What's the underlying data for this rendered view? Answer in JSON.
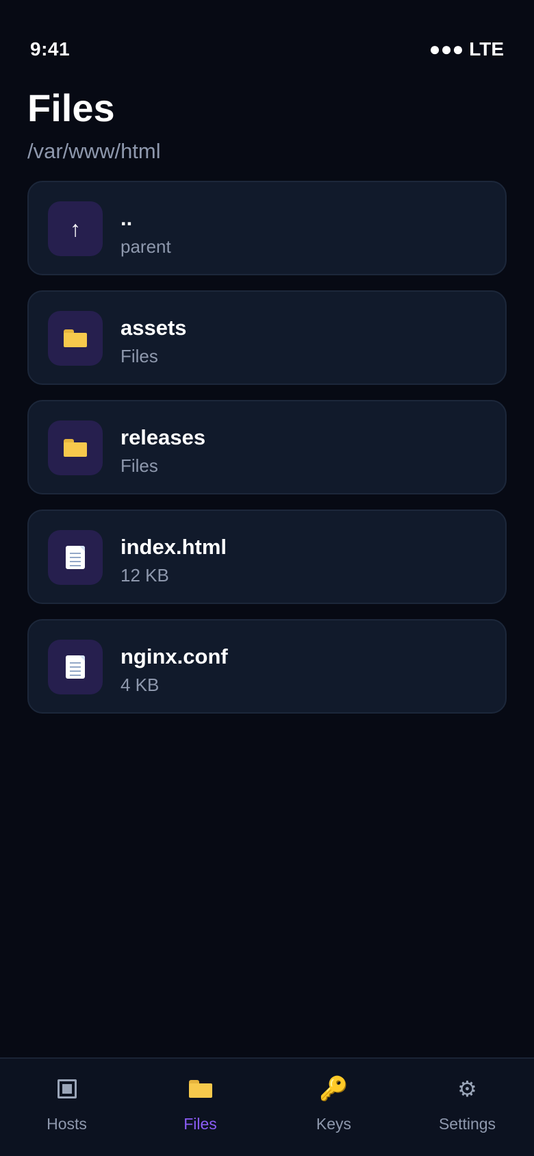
{
  "status_bar": {
    "time": "9:41",
    "signal": "●●● LTE"
  },
  "header": {
    "title": "Files",
    "path": "/var/www/html"
  },
  "files": [
    {
      "name": "..",
      "meta": "parent",
      "icon": "arrow-up-icon",
      "glyph": "↑"
    },
    {
      "name": "assets",
      "meta": "Files",
      "icon": "folder-icon"
    },
    {
      "name": "releases",
      "meta": "Files",
      "icon": "folder-icon"
    },
    {
      "name": "index.html",
      "meta": "12 KB",
      "icon": "document-icon"
    },
    {
      "name": "nginx.conf",
      "meta": "4 KB",
      "icon": "document-icon"
    }
  ],
  "tab_bar": {
    "tabs": [
      {
        "label": "Hosts",
        "icon": "hosts-icon"
      },
      {
        "label": "Files",
        "icon": "folder-icon",
        "active": true
      },
      {
        "label": "Keys",
        "icon": "key-icon",
        "glyph": "🔑"
      },
      {
        "label": "Settings",
        "icon": "gear-icon",
        "glyph": "⚙"
      }
    ]
  },
  "colors": {
    "background": "#070a14",
    "card": "#111a2b",
    "icon_box": "#261f4e",
    "accent": "#8b5cf6",
    "muted_text": "#8e98ad"
  }
}
